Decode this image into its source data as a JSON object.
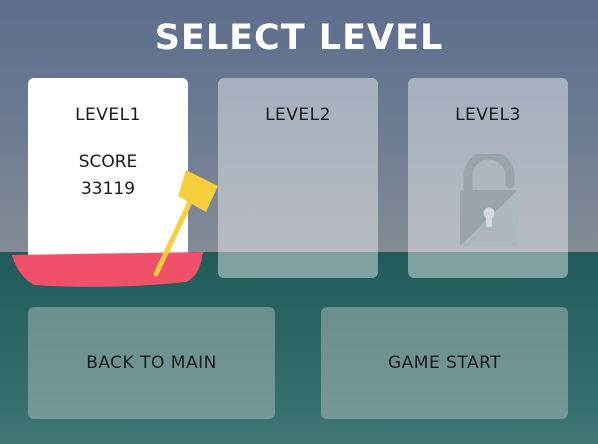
{
  "title": "SELECT LEVEL",
  "levels": [
    {
      "label": "LEVEL1",
      "score_label": "SCORE",
      "score": "33119",
      "state": "selected"
    },
    {
      "label": "LEVEL2",
      "state": "unlocked"
    },
    {
      "label": "LEVEL3",
      "state": "locked",
      "icon": "padlock-icon"
    }
  ],
  "buttons": {
    "back": "BACK TO MAIN",
    "start": "GAME START"
  },
  "colors": {
    "boat": "#f0506a",
    "paddle": "#f7cf3a",
    "sky": "#5d6d8c",
    "water": "#1f5c5a"
  }
}
